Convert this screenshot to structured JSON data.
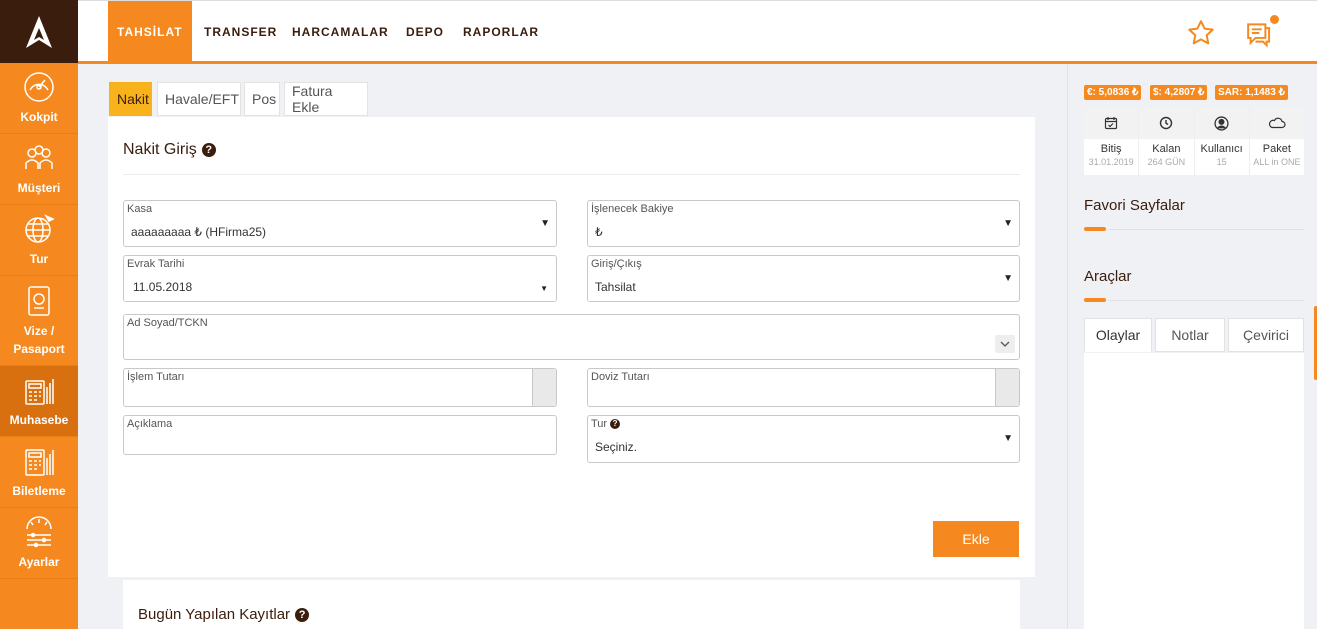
{
  "sidebar": {
    "items": [
      {
        "label": "Kokpit"
      },
      {
        "label": "Müşteri"
      },
      {
        "label": "Tur"
      },
      {
        "label": "Vize / Pasaport"
      },
      {
        "label": "Muhasebe"
      },
      {
        "label": "Biletleme"
      },
      {
        "label": "Ayarlar"
      }
    ]
  },
  "topnav": {
    "tabs": [
      {
        "label": "TAHSİLAT"
      },
      {
        "label": "TRANSFER"
      },
      {
        "label": "HARCAMALAR"
      },
      {
        "label": "DEPO"
      },
      {
        "label": "RAPORLAR"
      }
    ]
  },
  "subtabs": [
    {
      "label": "Nakit"
    },
    {
      "label": "Havale/EFT"
    },
    {
      "label": "Pos"
    },
    {
      "label": "Fatura Ekle"
    }
  ],
  "form": {
    "title": "Nakit Giriş",
    "kasa": {
      "label": "Kasa",
      "value": "aaaaaaaaa ₺ (HFirma25)"
    },
    "bakiye": {
      "label": "İşlenecek Bakiye",
      "value": "₺"
    },
    "evrak": {
      "label": "Evrak Tarihi",
      "value": "11.05.2018"
    },
    "giris": {
      "label": "Giriş/Çıkış",
      "value": "Tahsilat"
    },
    "adsoyad": {
      "label": "Ad Soyad/TCKN",
      "value": ""
    },
    "islem": {
      "label": "İşlem Tutarı",
      "value": ""
    },
    "doviz": {
      "label": "Doviz Tutarı",
      "value": ""
    },
    "aciklama": {
      "label": "Açıklama",
      "value": ""
    },
    "tur": {
      "label": "Tur",
      "value": "Seçiniz."
    },
    "submit_label": "Ekle"
  },
  "today": {
    "title": "Bugün Yapılan Kayıtlar"
  },
  "rates": [
    {
      "text": "€: 5,0836 ₺"
    },
    {
      "text": "$: 4,2807 ₺"
    },
    {
      "text": "SAR: 1,1483 ₺"
    }
  ],
  "stats": [
    {
      "label": "Bitiş",
      "sub": "31.01.2019",
      "icon": "calendar-icon"
    },
    {
      "label": "Kalan",
      "sub": "264 GÜN",
      "icon": "clock-icon"
    },
    {
      "label": "Kullanıcı",
      "sub": "15",
      "icon": "user-icon"
    },
    {
      "label": "Paket",
      "sub": "ALL in ONE",
      "icon": "cloud-icon"
    }
  ],
  "right": {
    "favorites_title": "Favori Sayfalar",
    "tools_title": "Araçlar",
    "tabs": [
      {
        "label": "Olaylar"
      },
      {
        "label": "Notlar"
      },
      {
        "label": "Çevirici"
      }
    ]
  },
  "colors": {
    "accent": "#f5891f",
    "dark": "#3a1d0c",
    "active_tab": "#f8b21c"
  }
}
